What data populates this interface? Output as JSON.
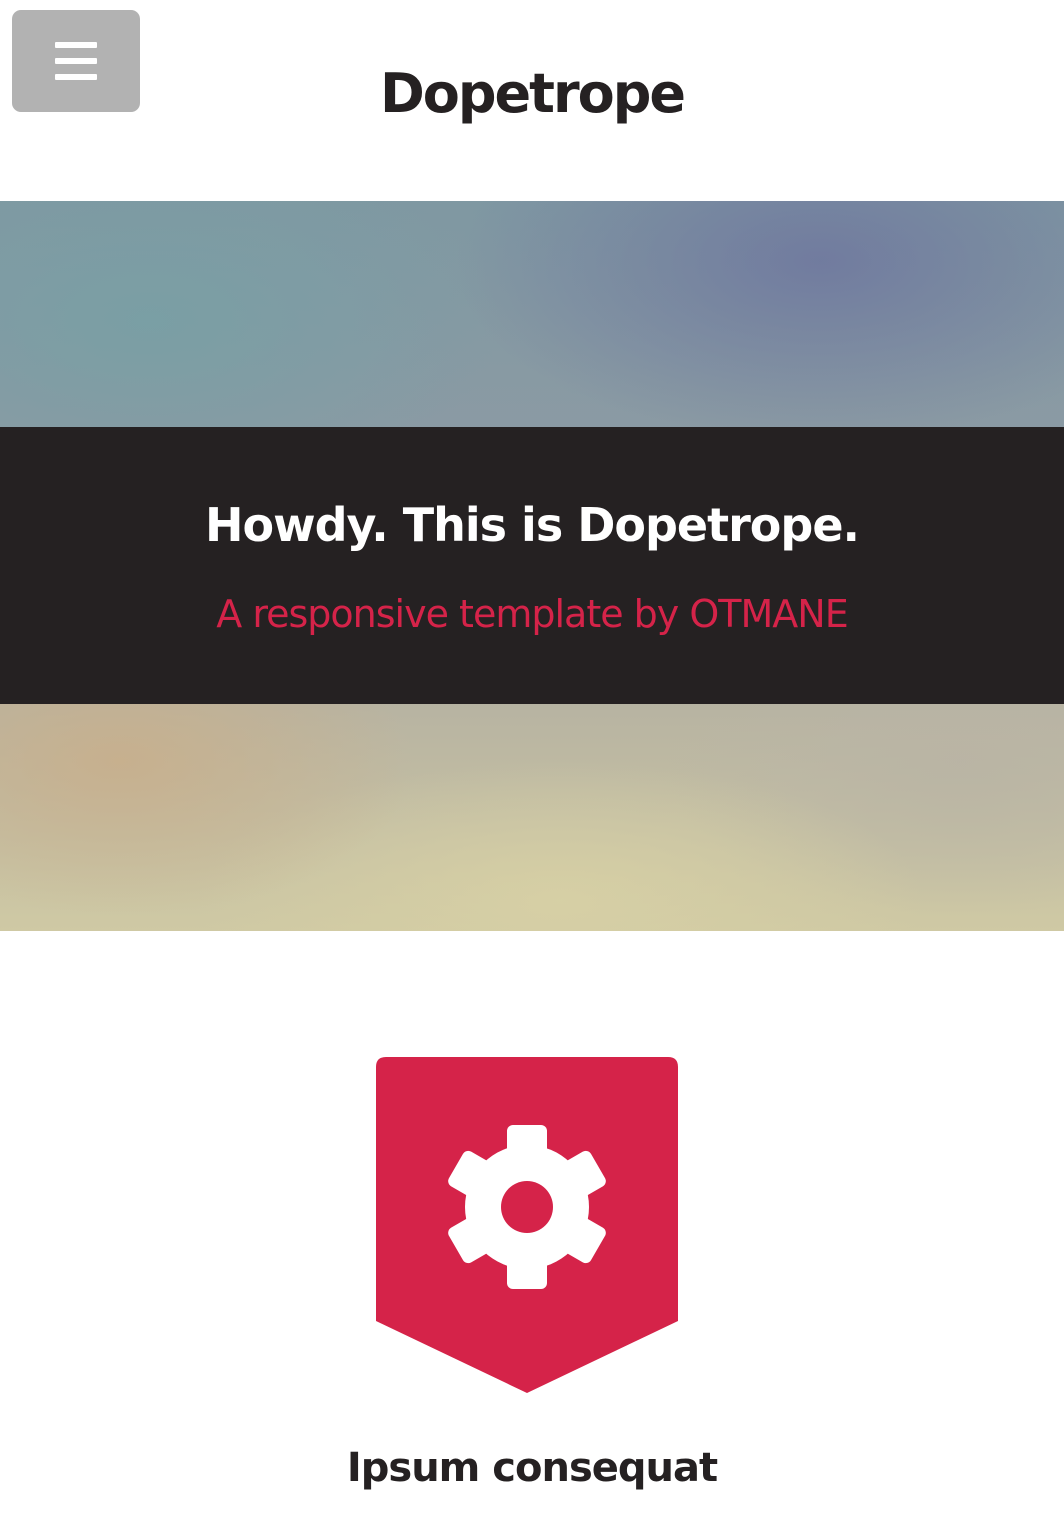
{
  "header": {
    "title": "Dopetrope",
    "menu_icon": "hamburger-menu-icon"
  },
  "banner": {
    "heading": "Howdy. This is Dopetrope.",
    "subheading": "A responsive template by OTMANE"
  },
  "feature": {
    "icon": "gear-icon",
    "title": "Ipsum consequat"
  },
  "colors": {
    "accent": "#d52349",
    "dark": "#252122",
    "menu_button": "#b2b2b2"
  }
}
